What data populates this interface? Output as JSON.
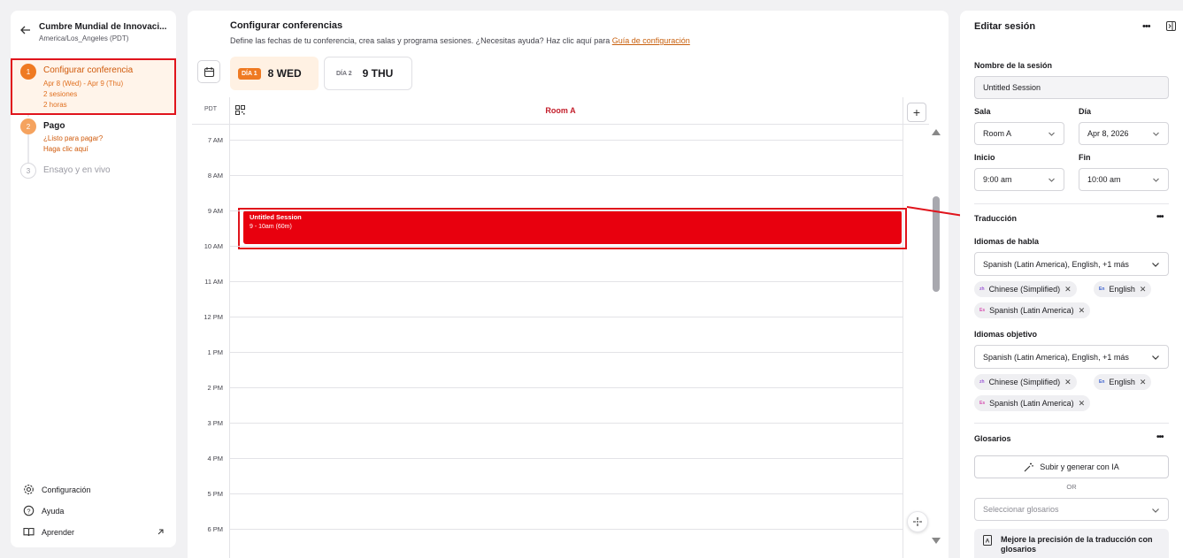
{
  "sidebar": {
    "conference_title": "Cumbre Mundial de Innovaci...",
    "timezone": "America/Los_Angeles (PDT)",
    "steps": [
      {
        "number": "1",
        "title": "Configurar conferencia",
        "lines": [
          "Apr 8 (Wed) - Apr 9 (Thu)",
          "2 sesiones",
          "2 horas"
        ]
      },
      {
        "number": "2",
        "title": "Pago",
        "lines": [
          "¿Listo para pagar?",
          "Haga clic aquí"
        ]
      },
      {
        "number": "3",
        "title": "Ensayo y en vivo"
      }
    ],
    "bottom_links": [
      {
        "label": "Configuración",
        "icon": "gear-icon"
      },
      {
        "label": "Ayuda",
        "icon": "help-icon"
      },
      {
        "label": "Aprender",
        "icon": "book-icon"
      }
    ]
  },
  "main": {
    "title": "Configurar conferencias",
    "subtitle": "Define las fechas de tu conferencia, crea salas y programa sesiones. ¿Necesitas ayuda? Haz clic aquí para",
    "guide_link": "Guía de configuración",
    "days": [
      {
        "pill": "DÍA 1",
        "label": "8 WED",
        "active": true
      },
      {
        "pill": "DÍA 2",
        "label": "9 THU",
        "active": false
      }
    ],
    "tz_label": "PDT",
    "room_name": "Room A",
    "add_label": "+",
    "hours": [
      "7 AM",
      "8 AM",
      "9 AM",
      "10 AM",
      "11 AM",
      "12 PM",
      "1 PM",
      "2 PM",
      "3 PM",
      "4 PM",
      "5 PM",
      "6 PM"
    ],
    "session": {
      "title": "Untitled Session",
      "time": "9 - 10am (60m)",
      "color": "#e8000e"
    }
  },
  "editor": {
    "title": "Editar sesión",
    "name_label": "Nombre de la sesión",
    "name_value": "Untitled Session",
    "room_label": "Sala",
    "room_value": "Room A",
    "day_label": "Día",
    "day_value": "Apr 8, 2026",
    "start_label": "Inicio",
    "start_value": "9:00 am",
    "end_label": "Fin",
    "end_value": "10:00 am",
    "translation_title": "Traducción",
    "spoken_label": "Idiomas de habla",
    "spoken_value": "Spanish (Latin America), English, +1 más",
    "spoken_chips": [
      {
        "icon": "zh",
        "label": "Chinese (Simplified)"
      },
      {
        "icon": "En",
        "label": "English"
      },
      {
        "icon": "Es",
        "label": "Spanish (Latin America)"
      }
    ],
    "target_label": "Idiomas objetivo",
    "target_value": "Spanish (Latin America), English, +1 más",
    "target_chips": [
      {
        "icon": "zh",
        "label": "Chinese (Simplified)"
      },
      {
        "icon": "En",
        "label": "English"
      },
      {
        "icon": "Es",
        "label": "Spanish (Latin America)"
      }
    ],
    "glossary_title": "Glosarios",
    "ai_button": "Subir y generar con IA",
    "or_text": "OR",
    "glossary_placeholder": "Seleccionar glosarios",
    "tip_text": "Mejore la precisión de la traducción con glosarios"
  },
  "colors": {
    "accent": "#ef7a22",
    "session": "#e8000e",
    "annotation": "#e0141c"
  }
}
